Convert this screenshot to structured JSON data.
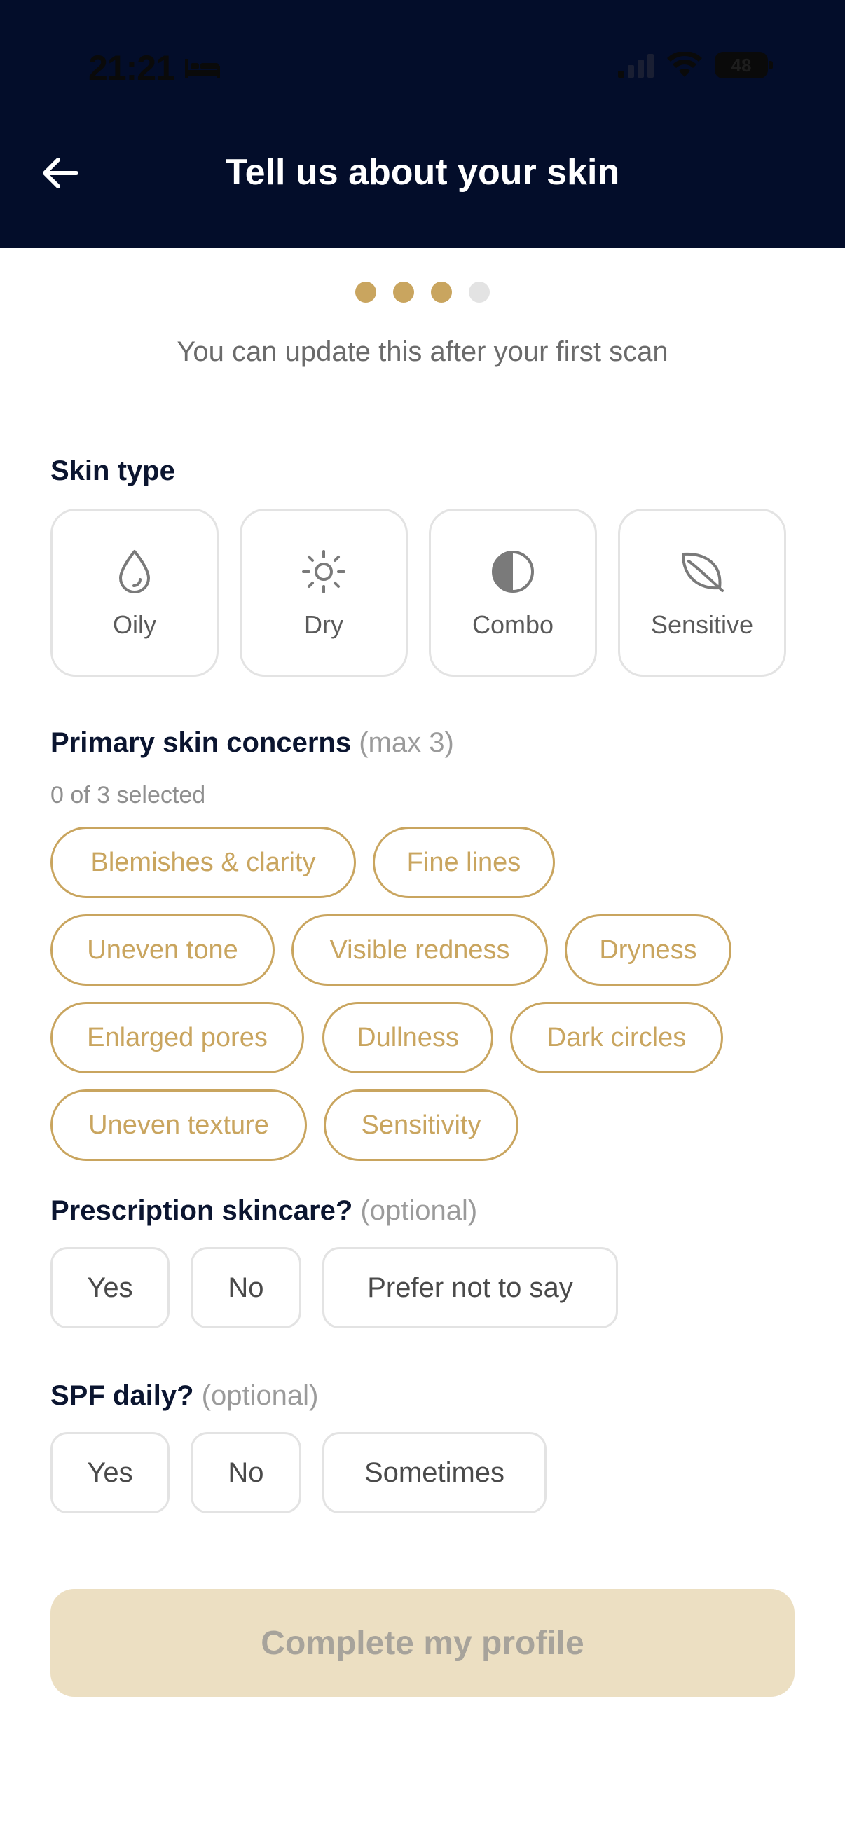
{
  "status_bar": {
    "time": "21:21",
    "battery": "48",
    "sleep_icon": "bed-icon"
  },
  "header": {
    "title": "Tell us about your skin",
    "back_icon": "arrow-left-icon"
  },
  "progress": {
    "total_steps": 4,
    "current_step": 3,
    "active_color": "#c9a55f",
    "inactive_color": "#e3e3e3"
  },
  "subtitle": "You can update this after your first scan",
  "skin_type": {
    "label": "Skin type",
    "options": [
      {
        "label": "Oily",
        "icon": "droplet-icon"
      },
      {
        "label": "Dry",
        "icon": "sun-icon"
      },
      {
        "label": "Combo",
        "icon": "half-circle-icon"
      },
      {
        "label": "Sensitive",
        "icon": "leaf-icon"
      }
    ]
  },
  "concerns": {
    "label": "Primary skin concerns",
    "hint": "(max 3)",
    "count_text": "0 of 3 selected",
    "options": [
      "Blemishes & clarity",
      "Fine lines",
      "Uneven tone",
      "Visible redness",
      "Dryness",
      "Enlarged pores",
      "Dullness",
      "Dark circles",
      "Uneven texture",
      "Sensitivity"
    ]
  },
  "prescription": {
    "label": "Prescription skincare?",
    "hint": "(optional)",
    "options": [
      "Yes",
      "No",
      "Prefer not to say"
    ]
  },
  "spf": {
    "label": "SPF daily?",
    "hint": "(optional)",
    "options": [
      "Yes",
      "No",
      "Sometimes"
    ]
  },
  "cta": {
    "label": "Complete my profile"
  },
  "colors": {
    "header_bg": "#030d2a",
    "accent": "#c9a55f",
    "cta_disabled_bg": "#ecdfc2"
  }
}
